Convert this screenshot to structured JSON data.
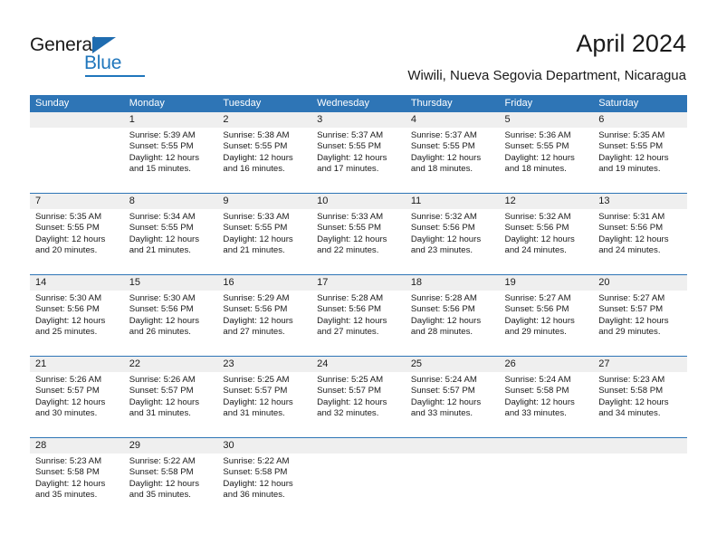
{
  "brand": {
    "name_part1": "General",
    "name_part2": "Blue",
    "accent_color": "#1f76bc"
  },
  "header": {
    "title": "April 2024",
    "subtitle": "Wiwili, Nueva Segovia Department, Nicaragua"
  },
  "calendar": {
    "header_bg": "#2e75b6",
    "daynum_bg": "#efefef",
    "weekdays": [
      "Sunday",
      "Monday",
      "Tuesday",
      "Wednesday",
      "Thursday",
      "Friday",
      "Saturday"
    ],
    "weeks": [
      [
        {
          "day": "",
          "sunrise": "",
          "sunset": "",
          "daylight": "",
          "daylight2": ""
        },
        {
          "day": "1",
          "sunrise": "Sunrise: 5:39 AM",
          "sunset": "Sunset: 5:55 PM",
          "daylight": "Daylight: 12 hours",
          "daylight2": "and 15 minutes."
        },
        {
          "day": "2",
          "sunrise": "Sunrise: 5:38 AM",
          "sunset": "Sunset: 5:55 PM",
          "daylight": "Daylight: 12 hours",
          "daylight2": "and 16 minutes."
        },
        {
          "day": "3",
          "sunrise": "Sunrise: 5:37 AM",
          "sunset": "Sunset: 5:55 PM",
          "daylight": "Daylight: 12 hours",
          "daylight2": "and 17 minutes."
        },
        {
          "day": "4",
          "sunrise": "Sunrise: 5:37 AM",
          "sunset": "Sunset: 5:55 PM",
          "daylight": "Daylight: 12 hours",
          "daylight2": "and 18 minutes."
        },
        {
          "day": "5",
          "sunrise": "Sunrise: 5:36 AM",
          "sunset": "Sunset: 5:55 PM",
          "daylight": "Daylight: 12 hours",
          "daylight2": "and 18 minutes."
        },
        {
          "day": "6",
          "sunrise": "Sunrise: 5:35 AM",
          "sunset": "Sunset: 5:55 PM",
          "daylight": "Daylight: 12 hours",
          "daylight2": "and 19 minutes."
        }
      ],
      [
        {
          "day": "7",
          "sunrise": "Sunrise: 5:35 AM",
          "sunset": "Sunset: 5:55 PM",
          "daylight": "Daylight: 12 hours",
          "daylight2": "and 20 minutes."
        },
        {
          "day": "8",
          "sunrise": "Sunrise: 5:34 AM",
          "sunset": "Sunset: 5:55 PM",
          "daylight": "Daylight: 12 hours",
          "daylight2": "and 21 minutes."
        },
        {
          "day": "9",
          "sunrise": "Sunrise: 5:33 AM",
          "sunset": "Sunset: 5:55 PM",
          "daylight": "Daylight: 12 hours",
          "daylight2": "and 21 minutes."
        },
        {
          "day": "10",
          "sunrise": "Sunrise: 5:33 AM",
          "sunset": "Sunset: 5:55 PM",
          "daylight": "Daylight: 12 hours",
          "daylight2": "and 22 minutes."
        },
        {
          "day": "11",
          "sunrise": "Sunrise: 5:32 AM",
          "sunset": "Sunset: 5:56 PM",
          "daylight": "Daylight: 12 hours",
          "daylight2": "and 23 minutes."
        },
        {
          "day": "12",
          "sunrise": "Sunrise: 5:32 AM",
          "sunset": "Sunset: 5:56 PM",
          "daylight": "Daylight: 12 hours",
          "daylight2": "and 24 minutes."
        },
        {
          "day": "13",
          "sunrise": "Sunrise: 5:31 AM",
          "sunset": "Sunset: 5:56 PM",
          "daylight": "Daylight: 12 hours",
          "daylight2": "and 24 minutes."
        }
      ],
      [
        {
          "day": "14",
          "sunrise": "Sunrise: 5:30 AM",
          "sunset": "Sunset: 5:56 PM",
          "daylight": "Daylight: 12 hours",
          "daylight2": "and 25 minutes."
        },
        {
          "day": "15",
          "sunrise": "Sunrise: 5:30 AM",
          "sunset": "Sunset: 5:56 PM",
          "daylight": "Daylight: 12 hours",
          "daylight2": "and 26 minutes."
        },
        {
          "day": "16",
          "sunrise": "Sunrise: 5:29 AM",
          "sunset": "Sunset: 5:56 PM",
          "daylight": "Daylight: 12 hours",
          "daylight2": "and 27 minutes."
        },
        {
          "day": "17",
          "sunrise": "Sunrise: 5:28 AM",
          "sunset": "Sunset: 5:56 PM",
          "daylight": "Daylight: 12 hours",
          "daylight2": "and 27 minutes."
        },
        {
          "day": "18",
          "sunrise": "Sunrise: 5:28 AM",
          "sunset": "Sunset: 5:56 PM",
          "daylight": "Daylight: 12 hours",
          "daylight2": "and 28 minutes."
        },
        {
          "day": "19",
          "sunrise": "Sunrise: 5:27 AM",
          "sunset": "Sunset: 5:56 PM",
          "daylight": "Daylight: 12 hours",
          "daylight2": "and 29 minutes."
        },
        {
          "day": "20",
          "sunrise": "Sunrise: 5:27 AM",
          "sunset": "Sunset: 5:57 PM",
          "daylight": "Daylight: 12 hours",
          "daylight2": "and 29 minutes."
        }
      ],
      [
        {
          "day": "21",
          "sunrise": "Sunrise: 5:26 AM",
          "sunset": "Sunset: 5:57 PM",
          "daylight": "Daylight: 12 hours",
          "daylight2": "and 30 minutes."
        },
        {
          "day": "22",
          "sunrise": "Sunrise: 5:26 AM",
          "sunset": "Sunset: 5:57 PM",
          "daylight": "Daylight: 12 hours",
          "daylight2": "and 31 minutes."
        },
        {
          "day": "23",
          "sunrise": "Sunrise: 5:25 AM",
          "sunset": "Sunset: 5:57 PM",
          "daylight": "Daylight: 12 hours",
          "daylight2": "and 31 minutes."
        },
        {
          "day": "24",
          "sunrise": "Sunrise: 5:25 AM",
          "sunset": "Sunset: 5:57 PM",
          "daylight": "Daylight: 12 hours",
          "daylight2": "and 32 minutes."
        },
        {
          "day": "25",
          "sunrise": "Sunrise: 5:24 AM",
          "sunset": "Sunset: 5:57 PM",
          "daylight": "Daylight: 12 hours",
          "daylight2": "and 33 minutes."
        },
        {
          "day": "26",
          "sunrise": "Sunrise: 5:24 AM",
          "sunset": "Sunset: 5:58 PM",
          "daylight": "Daylight: 12 hours",
          "daylight2": "and 33 minutes."
        },
        {
          "day": "27",
          "sunrise": "Sunrise: 5:23 AM",
          "sunset": "Sunset: 5:58 PM",
          "daylight": "Daylight: 12 hours",
          "daylight2": "and 34 minutes."
        }
      ],
      [
        {
          "day": "28",
          "sunrise": "Sunrise: 5:23 AM",
          "sunset": "Sunset: 5:58 PM",
          "daylight": "Daylight: 12 hours",
          "daylight2": "and 35 minutes."
        },
        {
          "day": "29",
          "sunrise": "Sunrise: 5:22 AM",
          "sunset": "Sunset: 5:58 PM",
          "daylight": "Daylight: 12 hours",
          "daylight2": "and 35 minutes."
        },
        {
          "day": "30",
          "sunrise": "Sunrise: 5:22 AM",
          "sunset": "Sunset: 5:58 PM",
          "daylight": "Daylight: 12 hours",
          "daylight2": "and 36 minutes."
        },
        {
          "day": "",
          "sunrise": "",
          "sunset": "",
          "daylight": "",
          "daylight2": ""
        },
        {
          "day": "",
          "sunrise": "",
          "sunset": "",
          "daylight": "",
          "daylight2": ""
        },
        {
          "day": "",
          "sunrise": "",
          "sunset": "",
          "daylight": "",
          "daylight2": ""
        },
        {
          "day": "",
          "sunrise": "",
          "sunset": "",
          "daylight": "",
          "daylight2": ""
        }
      ]
    ]
  }
}
